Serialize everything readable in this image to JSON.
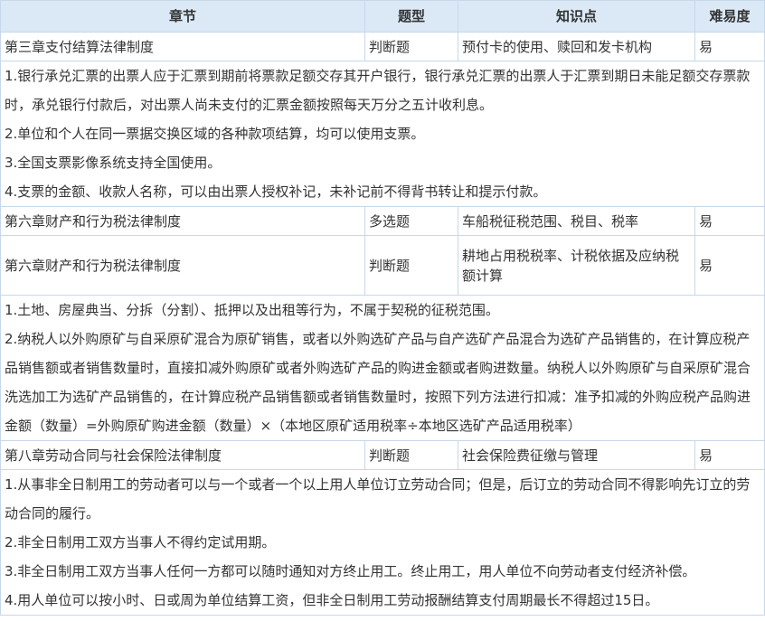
{
  "header": {
    "chapter": "章节",
    "type": "题型",
    "knowledge": "知识点",
    "difficulty": "难易度"
  },
  "rows": [
    {
      "chapter": "第三章支付结算法律制度",
      "type": "判断题",
      "knowledge": "预付卡的使用、赎回和发卡机构",
      "difficulty": "易"
    },
    {
      "details": [
        "1.银行承兑汇票的出票人应于汇票到期前将票款足额交存其开户银行，银行承兑汇票的出票人于汇票到期日未能足额交存票款时，承兑银行付款后，对出票人尚未支付的汇票金额按照每天万分之五计收利息。",
        "2.单位和个人在同一票据交换区域的各种款项结算，均可以使用支票。",
        "3.全国支票影像系统支持全国使用。",
        "4.支票的金额、收款人名称，可以由出票人授权补记，未补记前不得背书转让和提示付款。"
      ]
    },
    {
      "chapter": "第六章财产和行为税法律制度",
      "type": "多选题",
      "knowledge": "车船税征税范围、税目、税率",
      "difficulty": "易"
    },
    {
      "chapter": "第六章财产和行为税法律制度",
      "type": "判断题",
      "knowledge": "耕地占用税税率、计税依据及应纳税额计算",
      "difficulty": "易"
    },
    {
      "details": [
        "1.土地、房屋典当、分拆（分割）、抵押以及出租等行为，不属于契税的征税范围。",
        "2.纳税人以外购原矿与自采原矿混合为原矿销售，或者以外购选矿产品与自产选矿产品混合为选矿产品销售的，在计算应税产品销售额或者销售数量时，直接扣减外购原矿或者外购选矿产品的购进金额或者购进数量。纳税人以外购原矿与自采原矿混合洗选加工为选矿产品销售的，在计算应税产品销售额或者销售数量时，按照下列方法进行扣减：准予扣减的外购应税产品购进金额（数量）=外购原矿购进金额（数量）×（本地区原矿适用税率÷本地区选矿产品适用税率）"
      ]
    },
    {
      "chapter": "第八章劳动合同与社会保险法律制度",
      "type": "判断题",
      "knowledge": "社会保险费征缴与管理",
      "difficulty": "易"
    },
    {
      "details": [
        "1.从事非全日制用工的劳动者可以与一个或者一个以上用人单位订立劳动合同；但是，后订立的劳动合同不得影响先订立的劳动合同的履行。",
        "2.非全日制用工双方当事人不得约定试用期。",
        "3.非全日制用工双方当事人任何一方都可以随时通知对方终止用工。终止用工，用人单位不向劳动者支付经济补偿。",
        "4.用人单位可以按小时、日或周为单位结算工资，但非全日制用工劳动报酬结算支付周期最长不得超过15日。"
      ]
    }
  ]
}
